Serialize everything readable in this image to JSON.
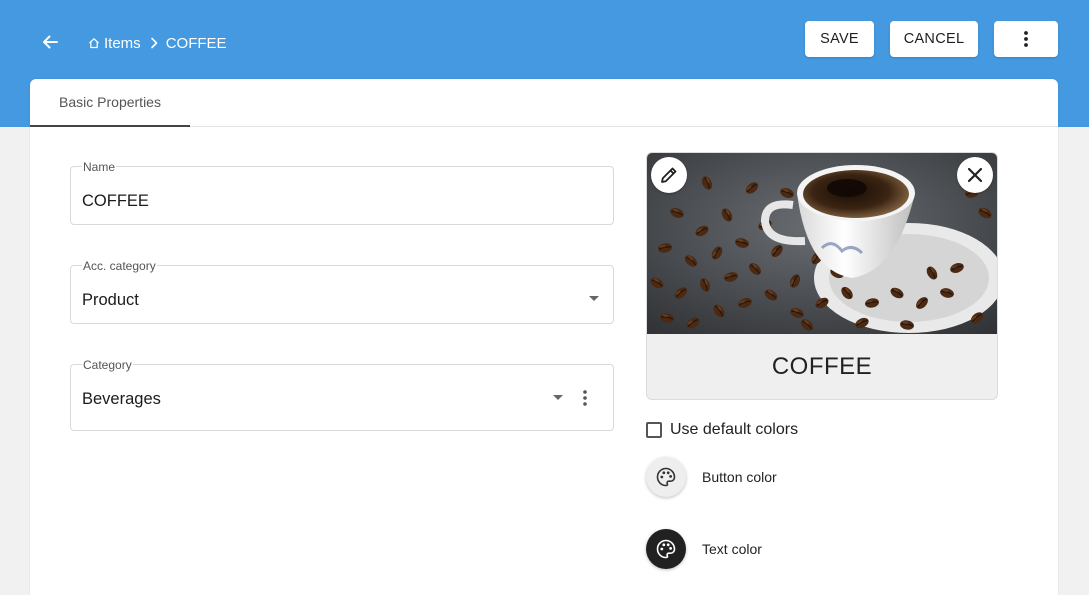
{
  "header": {
    "breadcrumb": {
      "parent": "Items",
      "current": "COFFEE"
    },
    "buttons": {
      "save": "SAVE",
      "cancel": "CANCEL"
    }
  },
  "tabs": [
    {
      "label": "Basic Properties",
      "active": true
    }
  ],
  "form": {
    "name": {
      "label": "Name",
      "value": "COFFEE"
    },
    "acc_category": {
      "label": "Acc. category",
      "value": "Product"
    },
    "category": {
      "label": "Category",
      "value": "Beverages"
    }
  },
  "preview": {
    "label": "COFFEE"
  },
  "options": {
    "use_default_colors": {
      "label": "Use default colors",
      "checked": false
    }
  },
  "colors": {
    "button_color": {
      "label": "Button color",
      "value": "#eeeeee"
    },
    "text_color": {
      "label": "Text color",
      "value": "#212121"
    }
  },
  "theme": {
    "accent": "#4499e0"
  },
  "icons": {
    "back": "arrow-left-icon",
    "home": "home-icon",
    "separator": "chevron-right-icon",
    "more": "more-vertical-icon",
    "edit": "pencil-icon",
    "close": "close-icon",
    "palette": "palette-icon",
    "dropdown": "caret-down-icon"
  }
}
